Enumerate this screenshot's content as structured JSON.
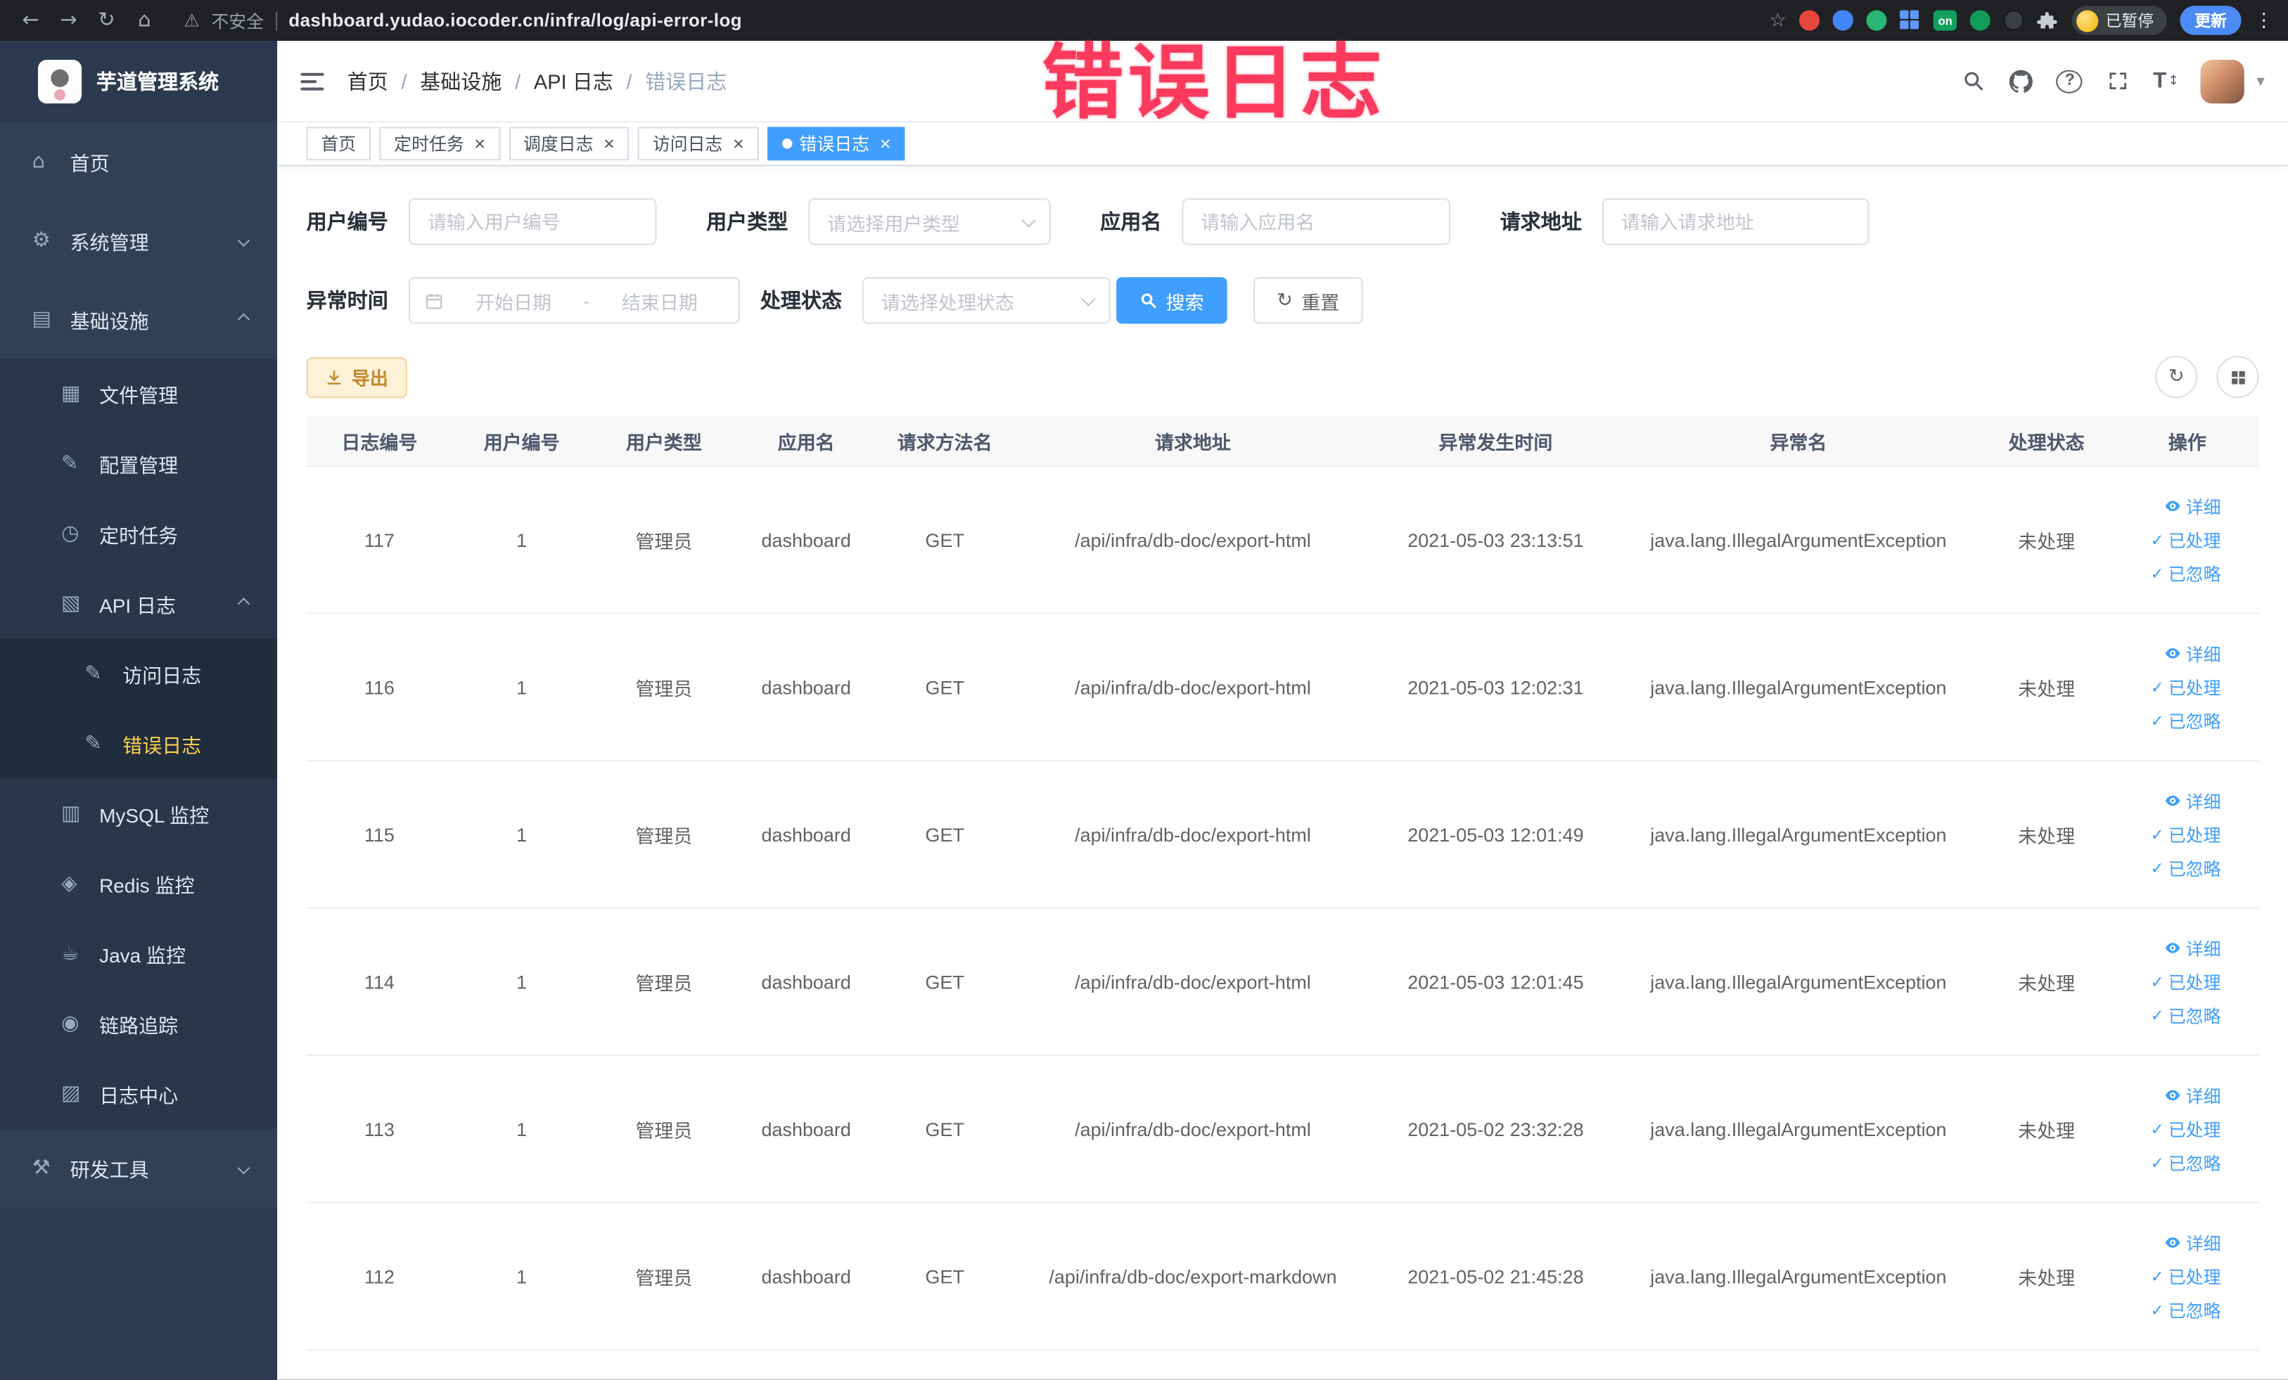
{
  "icons": {
    "back": "←",
    "forward": "→",
    "reload": "↻",
    "home": "⌂",
    "warning": "⚠",
    "star": "☆",
    "menu_dots": "⋮",
    "close": "×",
    "caret_down": "▾",
    "check": "✓",
    "question": "?",
    "font_size": "T",
    "updown": "↕"
  },
  "browser": {
    "security_label": "不安全",
    "url": "dashboard.yudao.iocoder.cn/infra/log/api-error-log",
    "extension_badge": "on",
    "profile_chip": "已暂停",
    "update_button": "更新"
  },
  "annotation": {
    "text": "错误日志"
  },
  "sidebar": {
    "logo_title": "芋道管理系统",
    "items": [
      {
        "id": "home",
        "label": "首页",
        "level": 0,
        "icon": "home-icon",
        "glyph": "⌂"
      },
      {
        "id": "system",
        "label": "系统管理",
        "level": 0,
        "icon": "gear-icon",
        "glyph": "⚙",
        "arrow": "down"
      },
      {
        "id": "infra",
        "label": "基础设施",
        "level": 0,
        "icon": "infra-icon",
        "glyph": "▤",
        "arrow": "up"
      },
      {
        "id": "file",
        "label": "文件管理",
        "level": 1,
        "icon": "folder-icon",
        "glyph": "▦"
      },
      {
        "id": "config",
        "label": "配置管理",
        "level": 1,
        "icon": "edit-icon",
        "glyph": "✎"
      },
      {
        "id": "job",
        "label": "定时任务",
        "level": 1,
        "icon": "clock-icon",
        "glyph": "◷"
      },
      {
        "id": "api-log",
        "label": "API 日志",
        "level": 1,
        "icon": "doc-icon",
        "glyph": "▧",
        "arrow": "up"
      },
      {
        "id": "access-log",
        "label": "访问日志",
        "level": 2,
        "icon": "edit-doc-icon",
        "glyph": "✎"
      },
      {
        "id": "error-log",
        "label": "错误日志",
        "level": 2,
        "icon": "edit-doc-icon",
        "glyph": "✎",
        "active": true
      },
      {
        "id": "mysql",
        "label": "MySQL 监控",
        "level": 1,
        "icon": "database-icon",
        "glyph": "▥"
      },
      {
        "id": "redis",
        "label": "Redis 监控",
        "level": 1,
        "icon": "redis-icon",
        "glyph": "◈"
      },
      {
        "id": "java",
        "label": "Java 监控",
        "level": 1,
        "icon": "java-icon",
        "glyph": "☕"
      },
      {
        "id": "trace",
        "label": "链路追踪",
        "level": 1,
        "icon": "trace-icon",
        "glyph": "◉"
      },
      {
        "id": "log-center",
        "label": "日志中心",
        "level": 1,
        "icon": "log-icon",
        "glyph": "▨"
      },
      {
        "id": "dev-tools",
        "label": "研发工具",
        "level": 0,
        "icon": "tool-icon",
        "glyph": "⚒",
        "arrow": "down"
      }
    ]
  },
  "breadcrumb": {
    "separator": "/",
    "items": [
      "首页",
      "基础设施",
      "API 日志",
      "错误日志"
    ]
  },
  "tabs": [
    {
      "id": "home",
      "label": "首页",
      "active": false,
      "closable": false
    },
    {
      "id": "job",
      "label": "定时任务",
      "active": false,
      "closable": true
    },
    {
      "id": "job-log",
      "label": "调度日志",
      "active": false,
      "closable": true
    },
    {
      "id": "access-log",
      "label": "访问日志",
      "active": false,
      "closable": true
    },
    {
      "id": "error-log",
      "label": "错误日志",
      "active": true,
      "closable": true
    }
  ],
  "filters": {
    "user_id": {
      "label": "用户编号",
      "placeholder": "请输入用户编号"
    },
    "user_type": {
      "label": "用户类型",
      "placeholder": "请选择用户类型"
    },
    "app_name": {
      "label": "应用名",
      "placeholder": "请输入应用名"
    },
    "request_url": {
      "label": "请求地址",
      "placeholder": "请输入请求地址"
    },
    "exception_time": {
      "label": "异常时间",
      "start_placeholder": "开始日期",
      "separator": "-",
      "end_placeholder": "结束日期"
    },
    "process_status": {
      "label": "处理状态",
      "placeholder": "请选择处理状态"
    },
    "search_button": "搜索",
    "reset_button": "重置"
  },
  "toolbar": {
    "export_button": "导出"
  },
  "table": {
    "columns": [
      "日志编号",
      "用户编号",
      "用户类型",
      "应用名",
      "请求方法名",
      "请求地址",
      "异常发生时间",
      "异常名",
      "处理状态",
      "操作"
    ],
    "actions": [
      {
        "id": "detail",
        "label": "详细"
      },
      {
        "id": "processed",
        "label": "已处理"
      },
      {
        "id": "ignored",
        "label": "已忽略"
      }
    ],
    "rows": [
      {
        "id": "117",
        "user_id": "1",
        "user_type": "管理员",
        "app": "dashboard",
        "method": "GET",
        "url": "/api/infra/db-doc/export-html",
        "time": "2021-05-03 23:13:51",
        "exception": "java.lang.IllegalArgumentException",
        "status": "未处理"
      },
      {
        "id": "116",
        "user_id": "1",
        "user_type": "管理员",
        "app": "dashboard",
        "method": "GET",
        "url": "/api/infra/db-doc/export-html",
        "time": "2021-05-03 12:02:31",
        "exception": "java.lang.IllegalArgumentException",
        "status": "未处理"
      },
      {
        "id": "115",
        "user_id": "1",
        "user_type": "管理员",
        "app": "dashboard",
        "method": "GET",
        "url": "/api/infra/db-doc/export-html",
        "time": "2021-05-03 12:01:49",
        "exception": "java.lang.IllegalArgumentException",
        "status": "未处理"
      },
      {
        "id": "114",
        "user_id": "1",
        "user_type": "管理员",
        "app": "dashboard",
        "method": "GET",
        "url": "/api/infra/db-doc/export-html",
        "time": "2021-05-03 12:01:45",
        "exception": "java.lang.IllegalArgumentException",
        "status": "未处理"
      },
      {
        "id": "113",
        "user_id": "1",
        "user_type": "管理员",
        "app": "dashboard",
        "method": "GET",
        "url": "/api/infra/db-doc/export-html",
        "time": "2021-05-02 23:32:28",
        "exception": "java.lang.IllegalArgumentException",
        "status": "未处理"
      },
      {
        "id": "112",
        "user_id": "1",
        "user_type": "管理员",
        "app": "dashboard",
        "method": "GET",
        "url": "/api/infra/db-doc/export-markdown",
        "time": "2021-05-02 21:45:28",
        "exception": "java.lang.IllegalArgumentException",
        "status": "未处理"
      }
    ]
  },
  "colors": {
    "primary": "#409eff",
    "warning": "#e6a23c",
    "sidebar_active": "#ffd04b",
    "annotation": "#fb3a5d"
  }
}
